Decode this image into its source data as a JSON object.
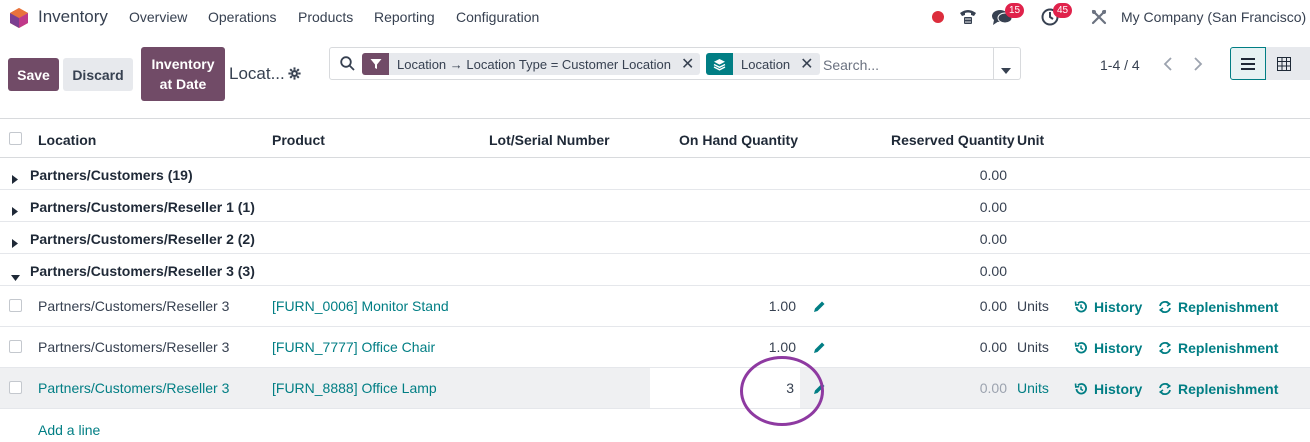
{
  "nav": {
    "app_title": "Inventory",
    "menu": [
      "Overview",
      "Operations",
      "Products",
      "Reporting",
      "Configuration"
    ],
    "messages_count": "15",
    "activities_count": "45",
    "company": "My Company (San Francisco)",
    "icons": [
      "odoo-logo-icon",
      "status-dot-icon",
      "phone-icon",
      "chat-icon",
      "clock-icon",
      "tools-icon"
    ]
  },
  "control": {
    "save_label": "Save",
    "discard_label": "Discard",
    "inventory_at_date_line1": "Inventory",
    "inventory_at_date_line2": "at Date",
    "breadcrumb": "Locat...",
    "pager": "1-4 / 4"
  },
  "search": {
    "facet_filter": "Location → Location Type = Customer Location",
    "facet_groupby": "Location",
    "placeholder": "Search..."
  },
  "table": {
    "headers": {
      "location": "Location",
      "product": "Product",
      "lot": "Lot/Serial Number",
      "on_hand": "On Hand Quantity",
      "reserved": "Reserved Quantity",
      "unit": "Unit"
    },
    "groups": [
      {
        "label": "Partners/Customers (19)",
        "reserved": "0.00",
        "expanded": false
      },
      {
        "label": "Partners/Customers/Reseller 1 (1)",
        "reserved": "0.00",
        "expanded": false
      },
      {
        "label": "Partners/Customers/Reseller 2 (2)",
        "reserved": "0.00",
        "expanded": false
      },
      {
        "label": "Partners/Customers/Reseller 3 (3)",
        "reserved": "0.00",
        "expanded": true
      }
    ],
    "rows": [
      {
        "location": "Partners/Customers/Reseller 3",
        "product": "[FURN_0006] Monitor Stand",
        "on_hand": "1.00",
        "reserved": "0.00",
        "unit": "Units",
        "history": "History",
        "replenishment": "Replenishment"
      },
      {
        "location": "Partners/Customers/Reseller 3",
        "product": "[FURN_7777] Office Chair",
        "on_hand": "1.00",
        "reserved": "0.00",
        "unit": "Units",
        "history": "History",
        "replenishment": "Replenishment"
      },
      {
        "location": "Partners/Customers/Reseller 3",
        "product": "[FURN_8888] Office Lamp",
        "on_hand": "3",
        "reserved": "0.00",
        "unit": "Units",
        "history": "History",
        "replenishment": "Replenishment"
      }
    ],
    "add_line": "Add a line"
  },
  "colors": {
    "brand": "#714b67",
    "link": "#017e84",
    "badge": "#e0224b",
    "annotation_circle": "#8e3aa1"
  }
}
